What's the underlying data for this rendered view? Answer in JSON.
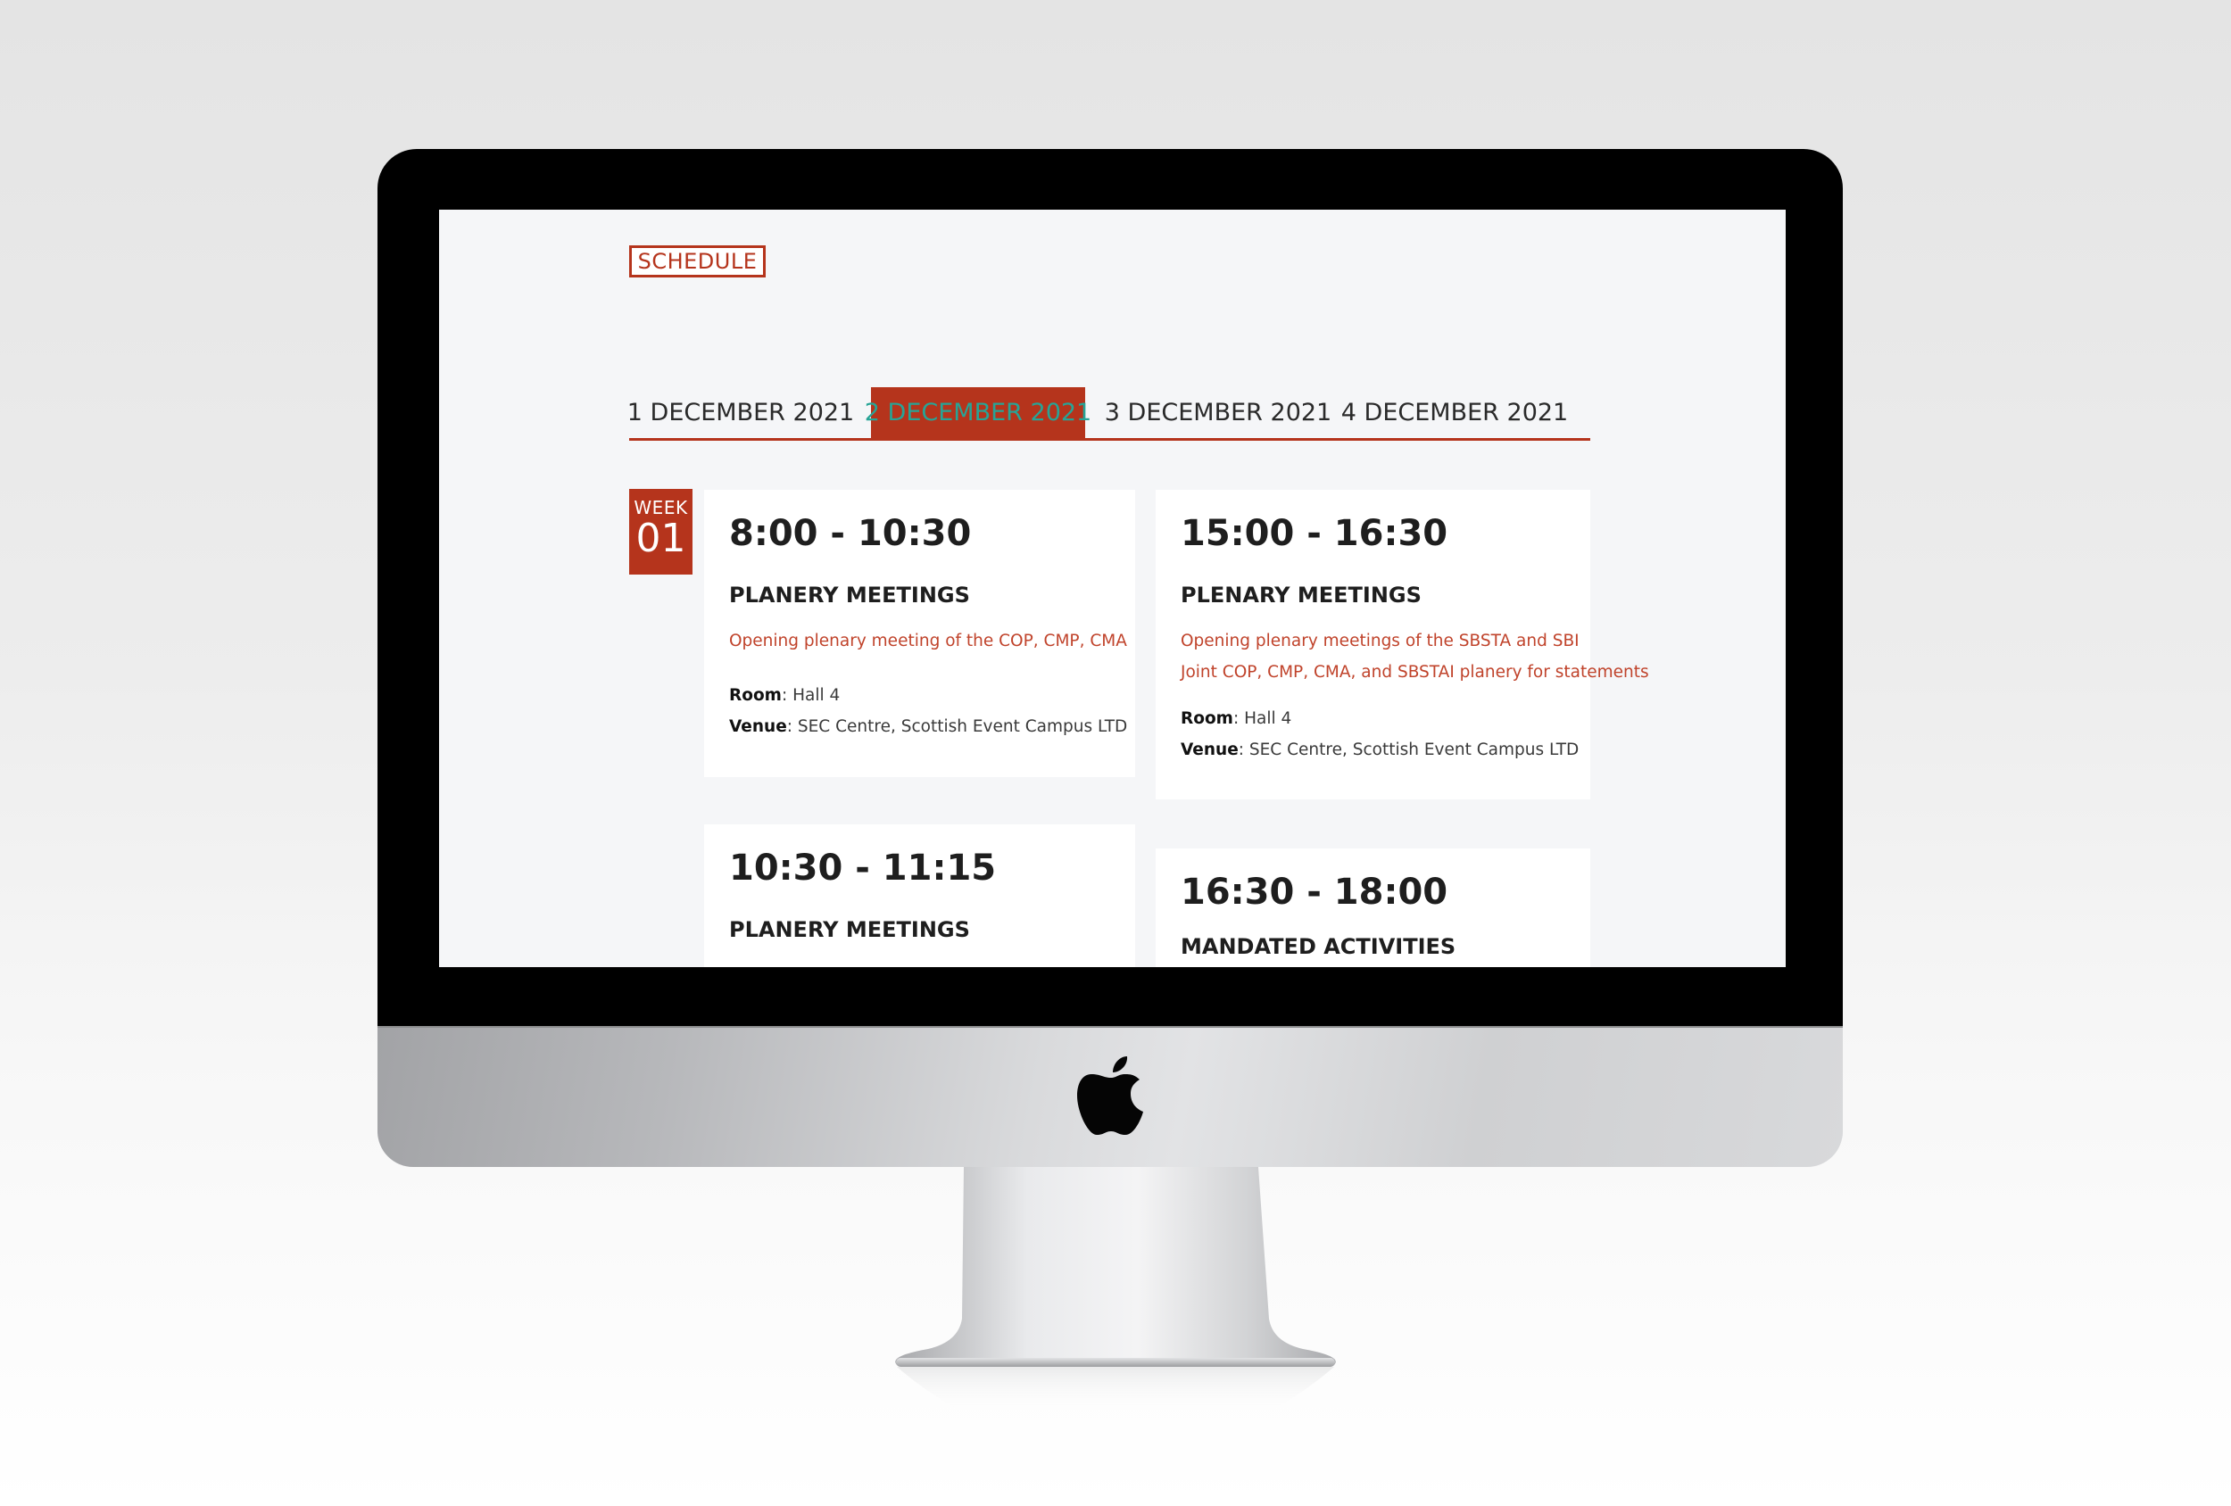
{
  "schedule_label": "SCHEDULE",
  "tabs": [
    {
      "label": "1 DECEMBER 2021"
    },
    {
      "label": "2 DECEMBER 2021"
    },
    {
      "label": "3 DECEMBER 2021"
    },
    {
      "label": "4 DECEMBER 2021"
    }
  ],
  "active_tab": "2 DECEMBER 2021",
  "week": {
    "label": "WEEK",
    "number": "01"
  },
  "sessions": [
    {
      "time": "8:00 - 10:30",
      "title": "PLANERY MEETINGS",
      "desc": [
        "Opening plenary meeting of the COP, CMP, CMA"
      ],
      "room_label": "Room",
      "room": ": Hall 4",
      "venue_label": "Venue",
      "venue": ": SEC Centre, Scottish Event Campus LTD"
    },
    {
      "time": "15:00 - 16:30",
      "title": "PLENARY MEETINGS",
      "desc": [
        "Opening plenary meetings of the SBSTA and SBI",
        "Joint COP, CMP, CMA, and SBSTAI planery for statements"
      ],
      "room_label": "Room",
      "room": ": Hall 4",
      "venue_label": "Venue",
      "venue": ": SEC Centre, Scottish Event Campus LTD"
    },
    {
      "time": "10:30 - 11:15",
      "title": "PLANERY MEETINGS"
    },
    {
      "time": "16:30 - 18:00",
      "title": "MANDATED ACTIVITIES"
    }
  ],
  "colors": {
    "accent": "#b5341c",
    "active_tab_text": "#27a496",
    "description_text": "#c0432b",
    "screen_background": "#f5f6f8"
  },
  "icons": {
    "brand_logo": "apple-logo-icon"
  }
}
